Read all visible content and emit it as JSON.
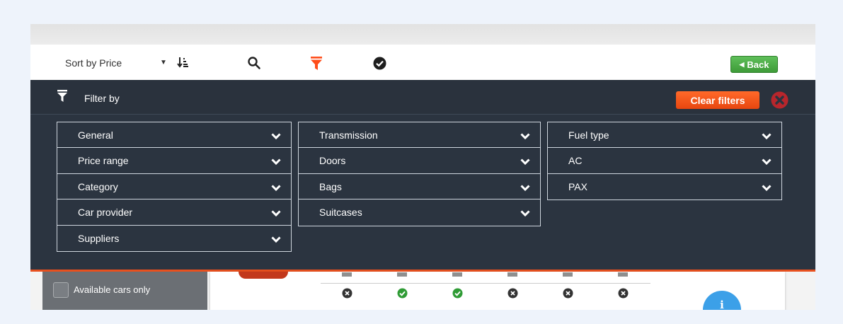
{
  "toolbar": {
    "sort_label": "Sort by Price",
    "icons": [
      "sort-direction-icon",
      "search-icon",
      "filter-icon",
      "check-circle-icon"
    ],
    "back_label": "Back",
    "accent_color": "#ff4d1a",
    "back_color": "#4cae47"
  },
  "filter_panel": {
    "title": "Filter by",
    "clear_label": "Clear filters",
    "columns": [
      [
        "General",
        "Price range",
        "Category",
        "Car provider",
        "Suppliers"
      ],
      [
        "Transmission",
        "Doors",
        "Bags",
        "Suitcases"
      ],
      [
        "Fuel type",
        "AC",
        "PAX"
      ]
    ]
  },
  "sidebar": {
    "available_only_label": "Available cars only",
    "available_only_checked": false
  },
  "car_card": {
    "features": [
      "no",
      "yes",
      "yes",
      "no",
      "no",
      "no"
    ],
    "info_label": "i"
  }
}
